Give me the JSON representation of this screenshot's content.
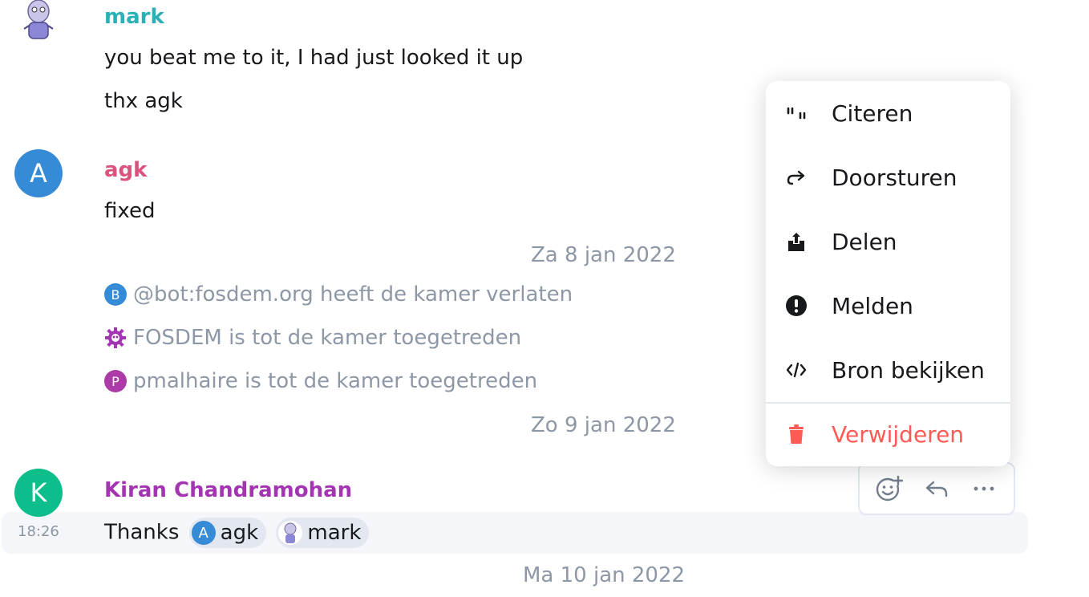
{
  "colors": {
    "mark": "#2bb0b6",
    "agk": "#d9537c",
    "kiran": "#a335b3",
    "avatar_blue": "#368bd6",
    "avatar_green": "#0dbd8b",
    "avatar_purple": "#ac3ba8",
    "muted": "#8d97a5",
    "danger": "#ff5b55"
  },
  "messages": {
    "mark": {
      "sender": "mark",
      "lines": [
        "you beat me to it, I had just looked it up",
        "thx agk"
      ]
    },
    "agk": {
      "avatar_letter": "A",
      "sender": "agk",
      "lines": [
        "fixed"
      ]
    },
    "kiran": {
      "avatar_letter": "K",
      "sender": "Kiran Chandramohan",
      "timestamp": "18:26",
      "text": "Thanks",
      "pills": [
        {
          "avatar": "A",
          "label": "agk"
        },
        {
          "avatar": "mark-avatar",
          "label": "mark"
        }
      ]
    }
  },
  "dates": [
    "Za 8 jan 2022",
    "Zo 9 jan 2022",
    "Ma 10 jan 2022"
  ],
  "events": [
    {
      "avatar": "B",
      "text": "@bot:fosdem.org heeft de kamer verlaten"
    },
    {
      "avatar": "fosdem-logo",
      "text": "FOSDEM is tot de kamer toegetreden"
    },
    {
      "avatar": "P",
      "text": "pmalhaire is tot de kamer toegetreden"
    }
  ],
  "context_menu": {
    "items": [
      {
        "icon": "quote-icon",
        "label": "Citeren"
      },
      {
        "icon": "forward-icon",
        "label": "Doorsturen"
      },
      {
        "icon": "share-icon",
        "label": "Delen"
      },
      {
        "icon": "report-icon",
        "label": "Melden"
      },
      {
        "icon": "code-icon",
        "label": "Bron bekijken"
      },
      {
        "icon": "trash-icon",
        "label": "Verwijderen"
      }
    ]
  },
  "action_bar": [
    "react-icon",
    "reply-icon",
    "options-icon"
  ]
}
